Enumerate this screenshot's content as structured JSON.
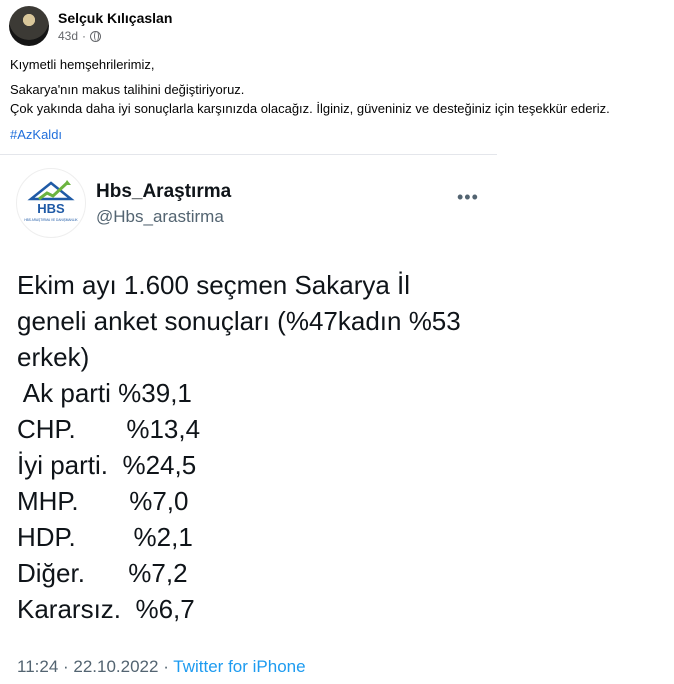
{
  "post": {
    "author": "Selçuk Kılıçaslan",
    "time": "43d",
    "separator": "·",
    "privacy_icon": "globe-icon",
    "lines": [
      "Kıymetli hemşehrilerimiz,",
      "Sakarya'nın makus talihini değiştiriyoruz.",
      "Çok yakında daha iyi sonuçlarla karşınızda olacağız. İlginiz, güveniniz ve desteğiniz için teşekkür ederiz."
    ],
    "hashtag": "#AzKaldı"
  },
  "tweet": {
    "logo_text": "HBS",
    "logo_subtext": "HBS ARAŞTIRMA VE DANIŞMANLIK",
    "name": "Hbs_Araştırma",
    "handle": "@Hbs_arastirma",
    "more": "•••",
    "body_lines": [
      "Ekim ayı 1.600 seçmen Sakarya İl",
      "geneli anket sonuçları (%47kadın %53",
      "erkek)",
      " Ak parti %39,1",
      "CHP.       %13,4",
      "İyi parti.  %24,5",
      "MHP.       %7,0",
      "HDP.        %2,1",
      "Diğer.      %7,2",
      "Kararsız.  %6,7"
    ],
    "timestamp": "11:24 · 22.10.2022 · ",
    "source": "Twitter for iPhone"
  }
}
